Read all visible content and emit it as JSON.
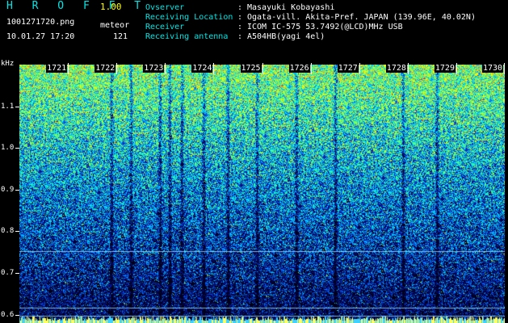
{
  "header": {
    "app_title": "H R O F F T",
    "version": "1.00",
    "filename": "1001271720.png",
    "event_type": "meteor",
    "datetime": "10.01.27 17:20",
    "count": "121",
    "info": [
      {
        "label": "Ovserver",
        "value": "Masayuki Kobayashi"
      },
      {
        "label": "Receiving Location",
        "value": "Ogata-vill. Akita-Pref. JAPAN (139.96E, 40.02N)"
      },
      {
        "label": "Receiver",
        "value": "ICOM IC-575 53.7492(@LCD)MHz USB"
      },
      {
        "label": "Receiving antenna",
        "value": "A504HB(yagi 4el)"
      }
    ]
  },
  "chart_data": {
    "type": "heatmap",
    "ylabel": "kHz",
    "yticks": [
      "1.1",
      "1.0",
      "0.9",
      "0.8",
      "0.7",
      "0.6"
    ],
    "ytick_values": [
      1.1,
      1.0,
      0.9,
      0.8,
      0.7,
      0.6
    ],
    "ylim": [
      0.58,
      1.2
    ],
    "xticks": [
      "1721",
      "1722",
      "1723",
      "1724",
      "1725",
      "1726",
      "1727",
      "1728",
      "1729",
      "1730"
    ],
    "xlim": [
      1720,
      1730
    ],
    "colormap": [
      "#000014",
      "#000060",
      "#0020c0",
      "#0080ff",
      "#00e0ff",
      "#20ffa0",
      "#c0ff20",
      "#ffff00",
      "#ff8000",
      "#ff0000"
    ],
    "horizontal_lines_khz": [
      0.752,
      0.617,
      0.597
    ],
    "vertical_streaks_min": [
      1721.9,
      1722.3,
      1722.9,
      1723.1,
      1723.35,
      1723.8,
      1724.3,
      1724.9,
      1725.7,
      1726.5,
      1727.9,
      1728.6
    ]
  },
  "colors": {
    "label": "#00e6e6",
    "text": "#ffffff",
    "accent": "#ffff00",
    "background": "#000000"
  }
}
